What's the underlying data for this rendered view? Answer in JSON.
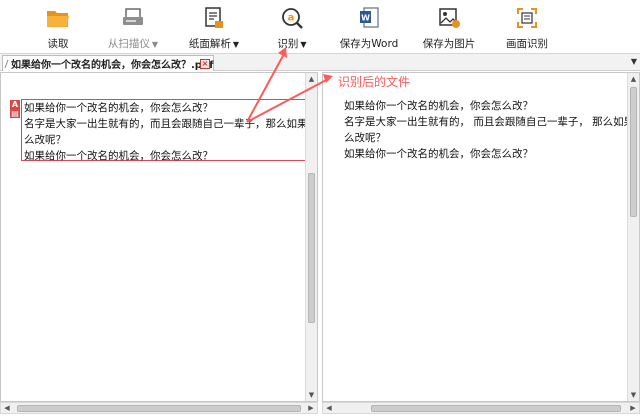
{
  "toolbar": {
    "items": [
      {
        "label": "读取",
        "icon": "folder-open-icon",
        "disabled": false
      },
      {
        "label": "从扫描仪",
        "icon": "scanner-icon",
        "disabled": true,
        "has_dropdown": true
      },
      {
        "label": "纸面解析",
        "icon": "document-analyze-icon",
        "disabled": false,
        "has_dropdown": true
      },
      {
        "label": "识别",
        "icon": "recognize-icon",
        "disabled": false,
        "has_dropdown": true
      },
      {
        "label": "保存为Word",
        "icon": "word-icon",
        "disabled": false
      },
      {
        "label": "保存为图片",
        "icon": "image-icon",
        "disabled": false
      },
      {
        "label": "画面识别",
        "icon": "screen-recognize-icon",
        "disabled": false
      }
    ],
    "dropdown_caret": "▼"
  },
  "tab": {
    "title": "如果给你一个改名的机会，你会怎么改？.pdf",
    "close": "×"
  },
  "annotation": {
    "text": "识别后的文件",
    "color": "#ff5a5a"
  },
  "left_doc": {
    "badge": "A",
    "lines": [
      "如果给你一个改名的机会，你会怎么改？",
      "名字是大家一出生就有的，而且会跟随自己一辈子，那么如果",
      "么改呢？",
      "如果给你一个改名的机会，你会怎么改？"
    ]
  },
  "right_doc": {
    "lines": [
      "如果给你一个改名的机会，你会怎么改？",
      "名字是大家一出生就有的，  而且会跟随自己一辈子，  那么如果对",
      "么改呢？",
      "如果给你一个改名的机会，你会怎么改？"
    ]
  },
  "colors": {
    "selection_border": "#d64a55",
    "folder": "#f0a030",
    "accent_red": "#d94848"
  }
}
